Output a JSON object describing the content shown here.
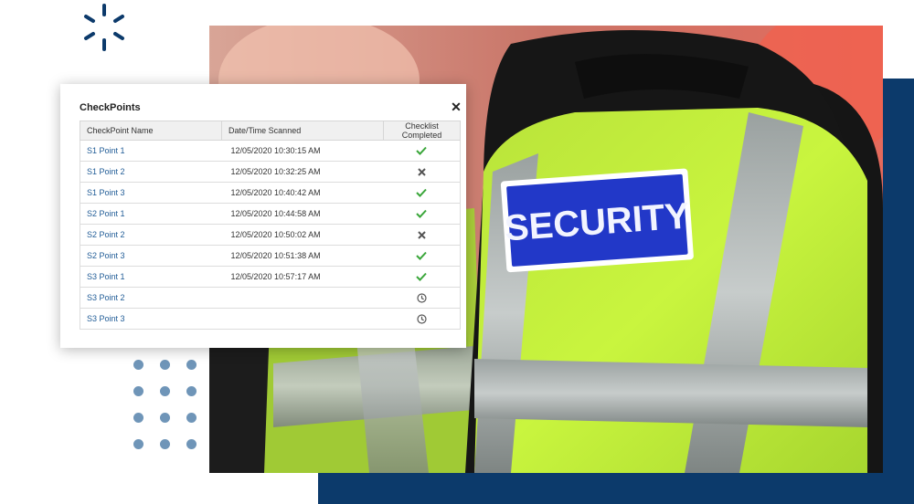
{
  "panel": {
    "title": "CheckPoints",
    "close_icon": "close-icon",
    "columns": [
      "CheckPoint Name",
      "Date/Time Scanned",
      "Checklist Completed"
    ],
    "rows": [
      {
        "name": "S1 Point 1",
        "datetime": "12/05/2020 10:30:15 AM",
        "status": "check-icon"
      },
      {
        "name": "S1 Point 2",
        "datetime": "12/05/2020 10:32:25 AM",
        "status": "x-icon"
      },
      {
        "name": "S1 Point 3",
        "datetime": "12/05/2020 10:40:42 AM",
        "status": "check-icon"
      },
      {
        "name": "S2 Point 1",
        "datetime": "12/05/2020 10:44:58 AM",
        "status": "check-icon"
      },
      {
        "name": "S2 Point 2",
        "datetime": "12/05/2020 10:50:02 AM",
        "status": "x-icon"
      },
      {
        "name": "S2 Point 3",
        "datetime": "12/05/2020 10:51:38 AM",
        "status": "check-icon"
      },
      {
        "name": "S3 Point 1",
        "datetime": "12/05/2020 10:57:17 AM",
        "status": "check-icon"
      },
      {
        "name": "S3 Point 2",
        "datetime": "",
        "status": "clock-icon"
      },
      {
        "name": "S3 Point 3",
        "datetime": "",
        "status": "clock-icon"
      }
    ]
  },
  "photo": {
    "vest_text": "SECURITY"
  },
  "colors": {
    "navy": "#0c3a6b",
    "link": "#1f5b96",
    "check_green": "#3aa63a",
    "x_gray": "#555555",
    "clock_gray": "#555555",
    "vest_yellow": "#c7f23a",
    "badge_blue": "#2238c8"
  }
}
